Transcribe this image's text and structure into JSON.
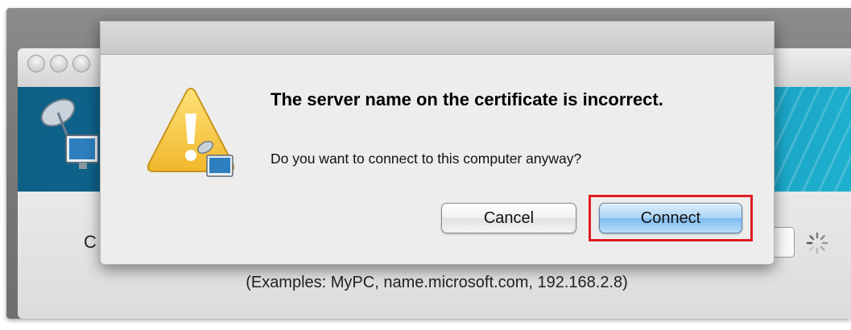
{
  "window": {
    "partial_label": "C",
    "examples_hint": "(Examples: MyPC, name.microsoft.com, 192.168.2.8)"
  },
  "dialog": {
    "title": "The server name on the certificate is incorrect.",
    "message": "Do you want to connect to this computer anyway?",
    "cancel_label": "Cancel",
    "connect_label": "Connect",
    "icon": "warning-icon",
    "highlight_color": "#e01b22"
  }
}
